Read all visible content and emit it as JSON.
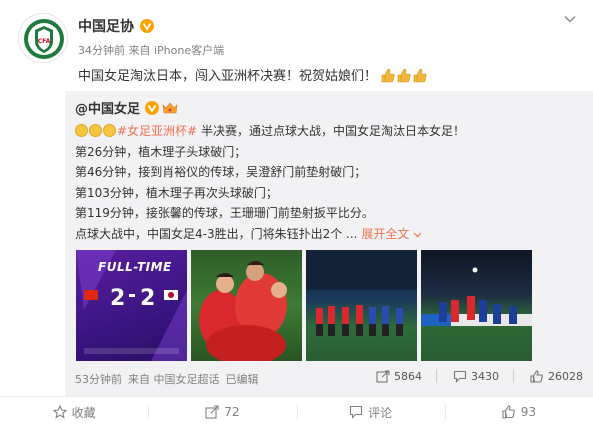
{
  "author": {
    "name": "中国足协",
    "badge_icon": "verified-v-icon",
    "time": "34分钟前",
    "source": "来自 iPhone客户端"
  },
  "post": {
    "text": "中国女足淘汰日本，闯入亚洲杯决赛！祝贺姑娘们！",
    "emoji": [
      "thumbs-up-icon",
      "thumbs-up-icon",
      "thumbs-up-icon"
    ]
  },
  "repost": {
    "author": "@中国女足",
    "hashtag": "#女足亚洲杯#",
    "line1_rest": "半决赛，通过点球大战，中国女足淘汰日本女足！",
    "lines": [
      "第26分钟，植木理子头球破门；",
      "第46分钟，接到肖裕仪的传球，吴澄舒门前垫射破门；",
      "第103分钟，植木理子再次头球破门；",
      "第119分钟，接张馨的传球，王珊珊门前垫射扳平比分。"
    ],
    "last_line": "点球大战中，中国女足4-3胜出，门将朱钰扑出2个 ...",
    "expand": "展开全文",
    "score_graphic": {
      "label": "FULL-TIME",
      "home_score": "2",
      "away_score": "2"
    },
    "time": "53分钟前",
    "source": "来自 中国女足超话",
    "edited": "已编辑",
    "stats": {
      "reposts": "5864",
      "comments": "3430",
      "likes": "26028"
    }
  },
  "footer": {
    "favorite": "收藏",
    "repost": "72",
    "comment": "评论",
    "like": "93"
  },
  "colors": {
    "accent": "#eb7350",
    "verified": "#ffa200",
    "muted": "#808080"
  }
}
